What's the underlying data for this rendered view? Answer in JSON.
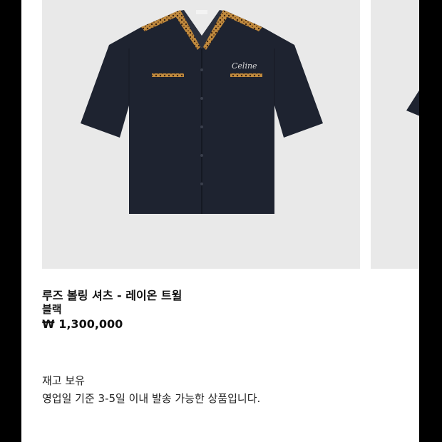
{
  "product": {
    "name": "루즈 볼링 셔츠 - 레이온 트윌",
    "color": "블랙",
    "price": "₩ 1,300,000",
    "brand_script": "Celine",
    "label_text": "CELINE"
  },
  "availability": {
    "stock": "재고 보유",
    "shipping": "영업일 기준 3-5일 이내 발송 가능한 상품입니다."
  },
  "colors": {
    "shirt": "#1e2330",
    "card_bg": "#e9e9e9",
    "trim": "#b8863a"
  }
}
